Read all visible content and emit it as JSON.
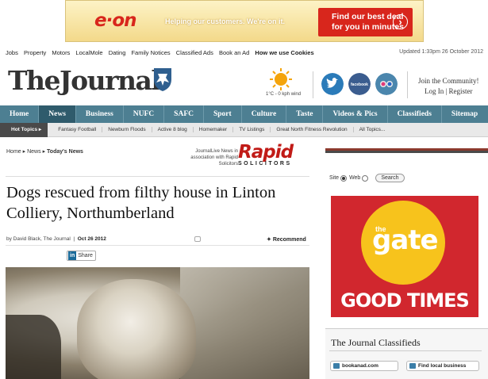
{
  "ad_banner": {
    "brand": "e·on",
    "tagline": "Helping our customers. We're on it.",
    "cta": [
      "Find our best deal",
      "for you in minutes"
    ],
    "cta_icon": "chevron-right-icon",
    "brand_color": "#d8261c"
  },
  "utility_links": [
    "Jobs",
    "Property",
    "Motors",
    "LocalMole",
    "Dating",
    "Family Notices",
    "Classified Ads",
    "Book an Ad"
  ],
  "cookies_link": "How we use Cookies",
  "updated": "Updated 1:33pm 26 October 2012",
  "masthead": {
    "logo": "TheJournal",
    "weather": "1°C - 0 kph wind",
    "join_line": "Join the Community!",
    "login": "Log In",
    "divider": "|",
    "register": "Register",
    "social_icons": [
      "twitter-icon",
      "facebook-icon",
      "flickr-icon"
    ]
  },
  "nav": {
    "items": [
      "Home",
      "News",
      "Business",
      "NUFC",
      "SAFC",
      "Sport",
      "Culture",
      "Taste",
      "Videos & Pics",
      "Classifieds",
      "Sitemap"
    ],
    "active": "News",
    "color": "#4d7f92"
  },
  "subnav": {
    "hot_label": "Hot Topics",
    "items": [
      "Fantasy Football",
      "Newburn Floods",
      "Active 8 blog",
      "Homemaker",
      "TV Listings",
      "Great North Fitness Revolution",
      "All Topics..."
    ]
  },
  "breadcrumb": [
    "Home",
    "News",
    "Today's News"
  ],
  "sponsor": {
    "note": "JournalLive News in association with Rapid Solicitors",
    "logo_main": "Rapid",
    "logo_sub": "SOLICITORS"
  },
  "article": {
    "headline": "Dogs rescued from filthy house in Linton Colliery, Northumberland",
    "byline_prefix": "by David Black, The Journal",
    "date": "Oct 26 2012",
    "recommend": "Recommend",
    "share_badge": "in",
    "share_label": "Share"
  },
  "sidebar": {
    "search_opt_site": "Site",
    "search_opt_web": "Web",
    "search_button": "Search",
    "ad": {
      "small": "the",
      "big": "gate",
      "slogan": "GOOD TIMES"
    },
    "classifieds_title": "The Journal Classifieds",
    "classified_buttons": [
      "bookanad.com",
      "Find local business"
    ]
  }
}
